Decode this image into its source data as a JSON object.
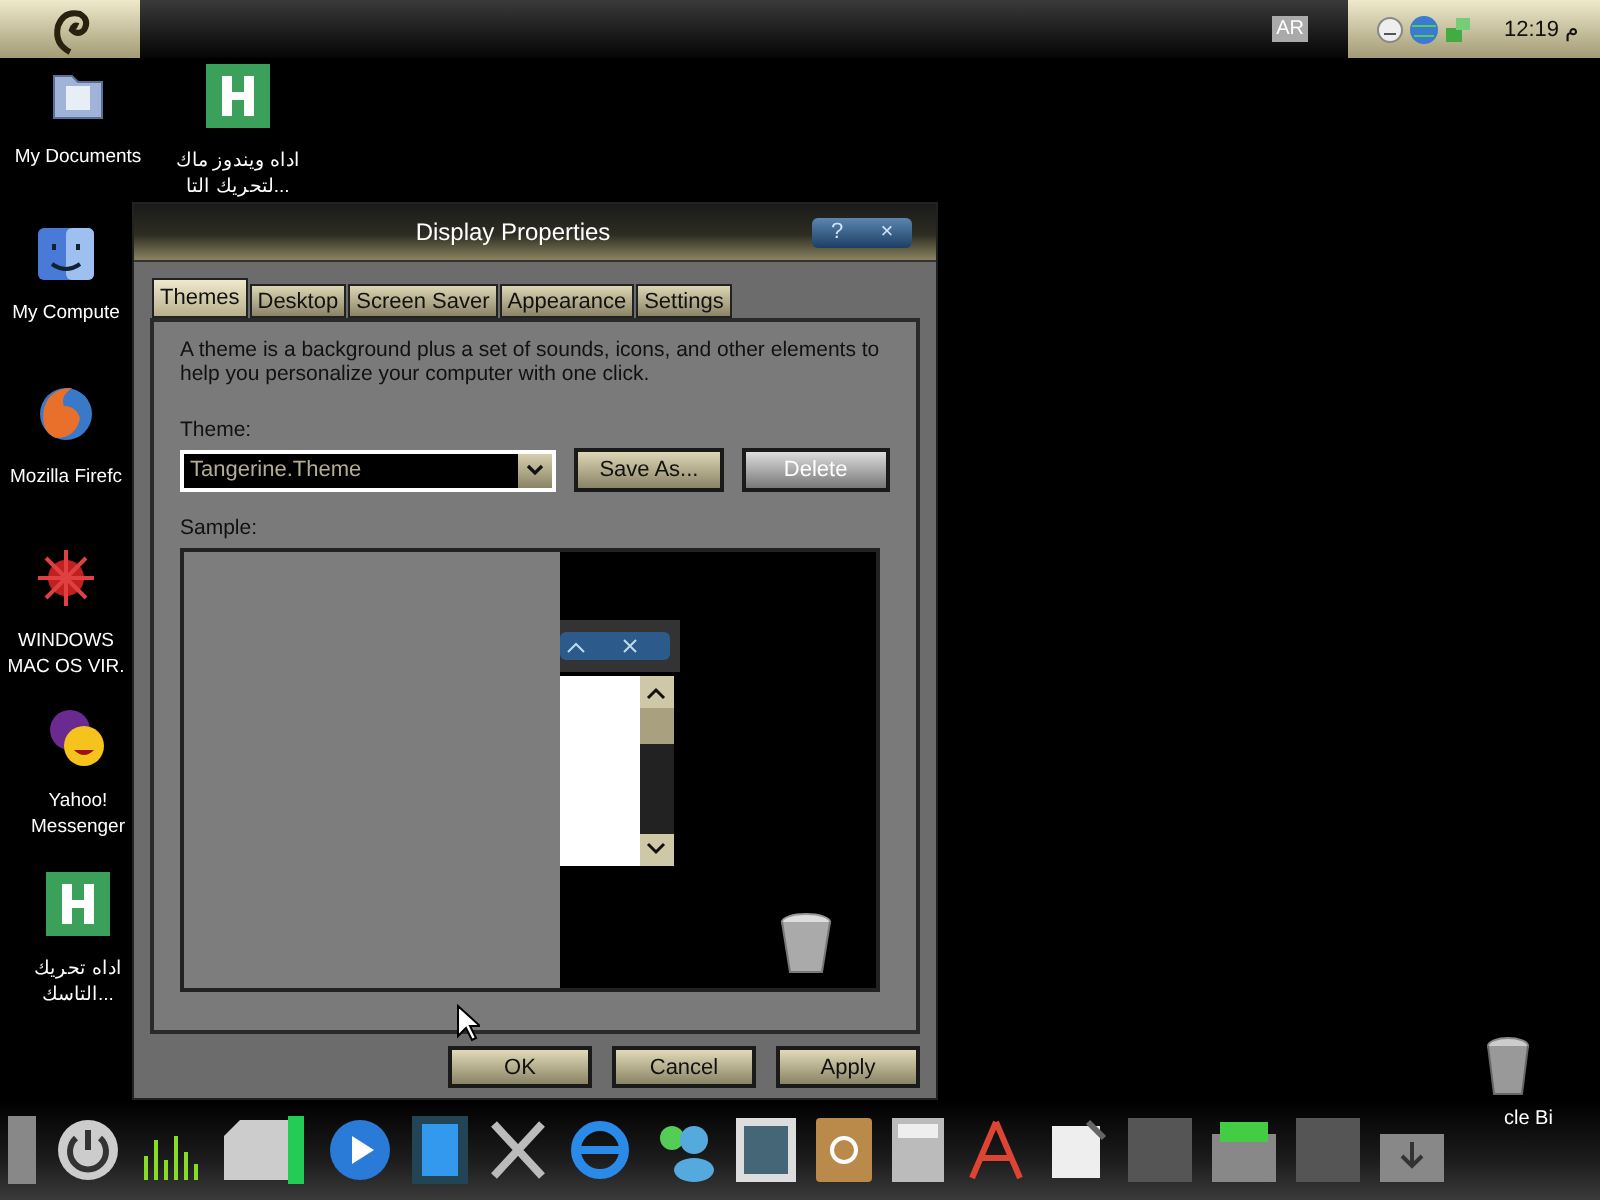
{
  "top_bar": {
    "language": "AR",
    "clock": "12:19 م"
  },
  "desktop_icons": [
    {
      "kind": "folder",
      "label": "My Documents"
    },
    {
      "kind": "app-h",
      "label": "اداه ويندوز ماك\nلتحريك التا..."
    },
    {
      "kind": "finder",
      "label": "My Compute"
    },
    {
      "kind": "firefox",
      "label": "Mozilla Firefc"
    },
    {
      "kind": "virus",
      "label": "WINDOWS\nMAC OS VIR."
    },
    {
      "kind": "yahoo",
      "label": "Yahoo!\nMessenger"
    },
    {
      "kind": "app-h",
      "label": "اداه تحريك\nالتاسك..."
    }
  ],
  "recycle_bin": {
    "label": "cle Bi"
  },
  "window": {
    "title": "Display Properties",
    "title_buttons": [
      "?",
      "×"
    ],
    "tabs": [
      {
        "label": "Themes",
        "selected": true
      },
      {
        "label": "Desktop",
        "selected": false
      },
      {
        "label": "Screen Saver",
        "selected": false
      },
      {
        "label": "Appearance",
        "selected": false
      },
      {
        "label": "Settings",
        "selected": false
      }
    ],
    "description": "A theme is a background plus a set of sounds, icons, and other elements to help you personalize your computer with one click.",
    "theme_label": "Theme:",
    "theme_value": "Tangerine.Theme",
    "theme_buttons": [
      {
        "label": "Save As...",
        "kind": "beige"
      },
      {
        "label": "Delete",
        "kind": "grey"
      }
    ],
    "sample_label": "Sample:",
    "footer_buttons": [
      "OK",
      "Cancel",
      "Apply"
    ]
  }
}
